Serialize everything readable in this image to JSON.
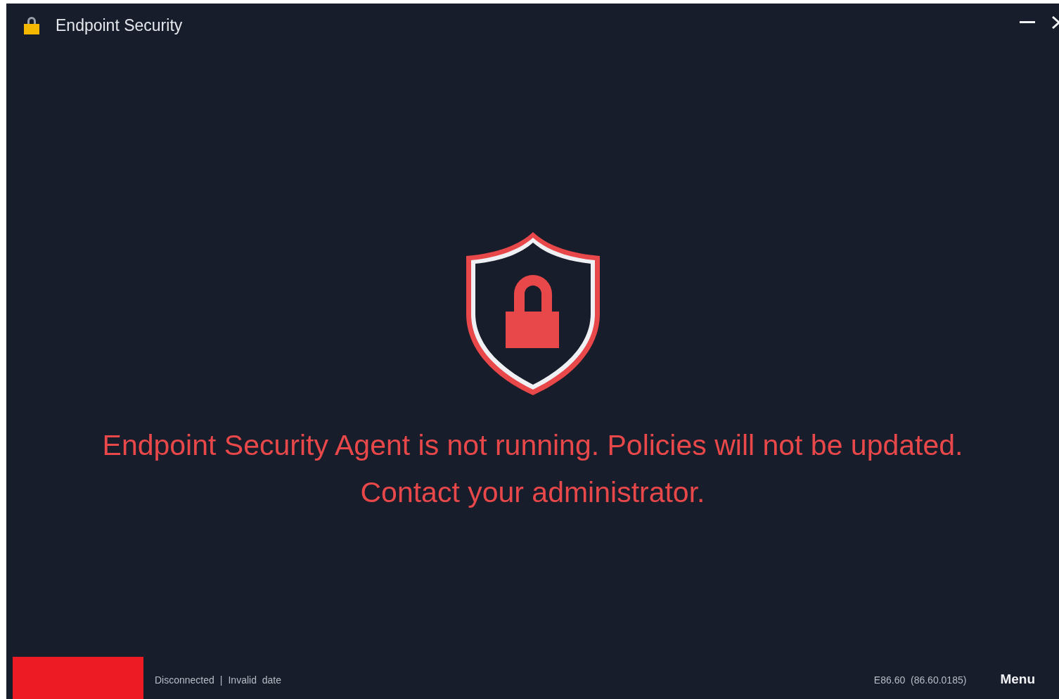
{
  "window": {
    "title": "Endpoint Security"
  },
  "message": {
    "lines": [
      "Endpoint Security Agent is not running. Policies will not be updated.",
      "Contact your administrator."
    ]
  },
  "status_bar": {
    "connection": "Disconnected",
    "separator": "|",
    "date": "Invalid  date",
    "version": "E86.60  (86.60.0185)",
    "menu": "Menu"
  }
}
